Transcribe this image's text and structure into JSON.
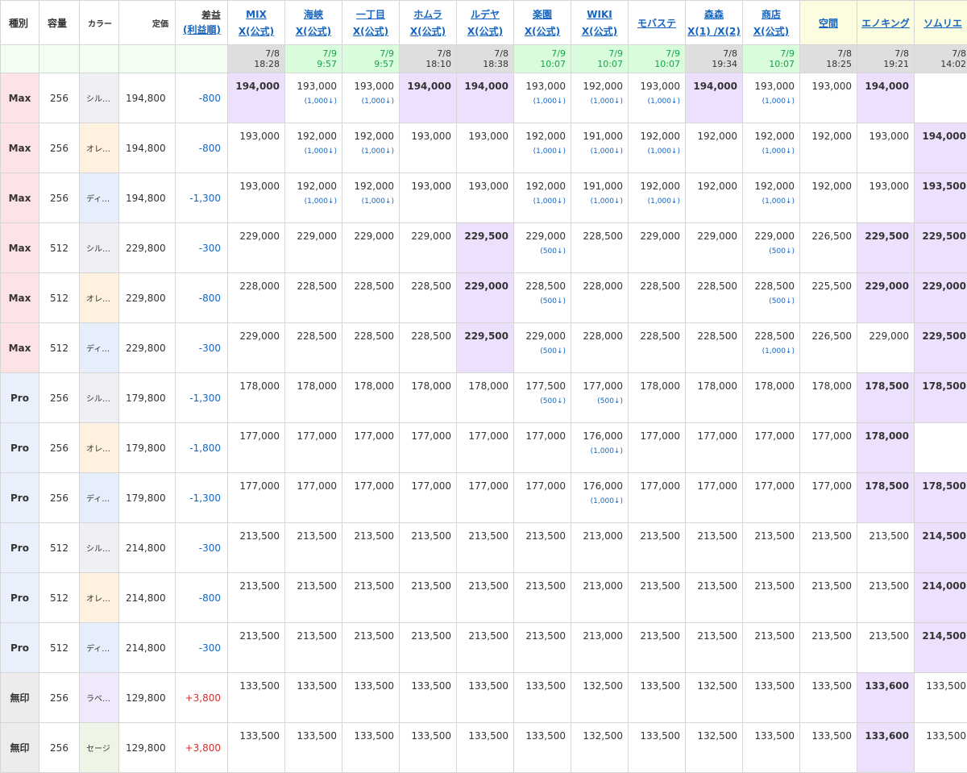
{
  "header": {
    "type": "種別",
    "capacity": "容量",
    "color": "カラー",
    "list_price": "定価",
    "diff_title": "差益",
    "diff_sort": "(利益順)"
  },
  "shops": [
    {
      "name": "MIX",
      "sub": "X(公式)",
      "date": "7/8",
      "time": "18:28",
      "time_style": "gray"
    },
    {
      "name": "海峡",
      "sub": "X(公式)",
      "date": "7/9",
      "time": "9:57",
      "time_style": "green"
    },
    {
      "name": "一丁目",
      "sub": "X(公式)",
      "date": "7/9",
      "time": "9:57",
      "time_style": "green"
    },
    {
      "name": "ホムラ",
      "sub": "X(公式)",
      "date": "7/8",
      "time": "18:10",
      "time_style": "gray"
    },
    {
      "name": "ルデヤ",
      "sub": "X(公式)",
      "date": "7/8",
      "time": "18:38",
      "time_style": "gray"
    },
    {
      "name": "楽園",
      "sub": "X(公式)",
      "date": "7/9",
      "time": "10:07",
      "time_style": "green"
    },
    {
      "name": "WIKI",
      "sub": "X(公式)",
      "date": "7/9",
      "time": "10:07",
      "time_style": "green"
    },
    {
      "name": "モバステ",
      "sub": "",
      "date": "7/9",
      "time": "10:07",
      "time_style": "green"
    },
    {
      "name": "森森",
      "sub": "X(1) /X(2)",
      "date": "7/8",
      "time": "19:34",
      "time_style": "gray"
    },
    {
      "name": "商店",
      "sub": "X(公式)",
      "date": "7/9",
      "time": "10:07",
      "time_style": "green"
    },
    {
      "name": "空間",
      "sub": "",
      "date": "7/8",
      "time": "18:25",
      "time_style": "gray"
    },
    {
      "name": "エノキング",
      "sub": "",
      "date": "7/8",
      "time": "19:21",
      "time_style": "gray"
    },
    {
      "name": "ソムリエ",
      "sub": "",
      "date": "7/8",
      "time": "14:02",
      "time_style": "gray"
    }
  ],
  "rows": [
    {
      "type": "Max",
      "cap": "256",
      "color": "シル…",
      "color_key": "silver",
      "list": "194,800",
      "diff": "-800",
      "prices": [
        [
          "194,000",
          "",
          1
        ],
        [
          "193,000",
          "(1,000↓)",
          0
        ],
        [
          "193,000",
          "(1,000↓)",
          0
        ],
        [
          "194,000",
          "",
          1
        ],
        [
          "194,000",
          "",
          1
        ],
        [
          "193,000",
          "(1,000↓)",
          0
        ],
        [
          "192,000",
          "(1,000↓)",
          0
        ],
        [
          "193,000",
          "(1,000↓)",
          0
        ],
        [
          "194,000",
          "",
          1
        ],
        [
          "193,000",
          "(1,000↓)",
          0
        ],
        [
          "193,000",
          "",
          0
        ],
        [
          "194,000",
          "",
          1
        ],
        [
          "",
          "",
          0
        ]
      ]
    },
    {
      "type": "Max",
      "cap": "256",
      "color": "オレ…",
      "color_key": "orange",
      "list": "194,800",
      "diff": "-800",
      "prices": [
        [
          "193,000",
          "",
          0
        ],
        [
          "192,000",
          "(1,000↓)",
          0
        ],
        [
          "192,000",
          "(1,000↓)",
          0
        ],
        [
          "193,000",
          "",
          0
        ],
        [
          "193,000",
          "",
          0
        ],
        [
          "192,000",
          "(1,000↓)",
          0
        ],
        [
          "191,000",
          "(1,000↓)",
          0
        ],
        [
          "192,000",
          "(1,000↓)",
          0
        ],
        [
          "192,000",
          "",
          0
        ],
        [
          "192,000",
          "(1,000↓)",
          0
        ],
        [
          "192,000",
          "",
          0
        ],
        [
          "193,000",
          "",
          0
        ],
        [
          "194,000",
          "",
          1
        ]
      ]
    },
    {
      "type": "Max",
      "cap": "256",
      "color": "ディ…",
      "color_key": "deep",
      "list": "194,800",
      "diff": "-1,300",
      "prices": [
        [
          "193,000",
          "",
          0
        ],
        [
          "192,000",
          "(1,000↓)",
          0
        ],
        [
          "192,000",
          "(1,000↓)",
          0
        ],
        [
          "193,000",
          "",
          0
        ],
        [
          "193,000",
          "",
          0
        ],
        [
          "192,000",
          "(1,000↓)",
          0
        ],
        [
          "191,000",
          "(1,000↓)",
          0
        ],
        [
          "192,000",
          "(1,000↓)",
          0
        ],
        [
          "192,000",
          "",
          0
        ],
        [
          "192,000",
          "(1,000↓)",
          0
        ],
        [
          "192,000",
          "",
          0
        ],
        [
          "193,000",
          "",
          0
        ],
        [
          "193,500",
          "",
          1
        ]
      ]
    },
    {
      "type": "Max",
      "cap": "512",
      "color": "シル…",
      "color_key": "silver",
      "list": "229,800",
      "diff": "-300",
      "prices": [
        [
          "229,000",
          "",
          0
        ],
        [
          "229,000",
          "",
          0
        ],
        [
          "229,000",
          "",
          0
        ],
        [
          "229,000",
          "",
          0
        ],
        [
          "229,500",
          "",
          1
        ],
        [
          "229,000",
          "(500↓)",
          0
        ],
        [
          "228,500",
          "",
          0
        ],
        [
          "229,000",
          "",
          0
        ],
        [
          "229,000",
          "",
          0
        ],
        [
          "229,000",
          "(500↓)",
          0
        ],
        [
          "226,500",
          "",
          0
        ],
        [
          "229,500",
          "",
          1
        ],
        [
          "229,500",
          "",
          1
        ]
      ]
    },
    {
      "type": "Max",
      "cap": "512",
      "color": "オレ…",
      "color_key": "orange",
      "list": "229,800",
      "diff": "-800",
      "prices": [
        [
          "228,000",
          "",
          0
        ],
        [
          "228,500",
          "",
          0
        ],
        [
          "228,500",
          "",
          0
        ],
        [
          "228,500",
          "",
          0
        ],
        [
          "229,000",
          "",
          1
        ],
        [
          "228,500",
          "(500↓)",
          0
        ],
        [
          "228,000",
          "",
          0
        ],
        [
          "228,500",
          "",
          0
        ],
        [
          "228,500",
          "",
          0
        ],
        [
          "228,500",
          "(500↓)",
          0
        ],
        [
          "225,500",
          "",
          0
        ],
        [
          "229,000",
          "",
          1
        ],
        [
          "229,000",
          "",
          1
        ]
      ]
    },
    {
      "type": "Max",
      "cap": "512",
      "color": "ディ…",
      "color_key": "deep",
      "list": "229,800",
      "diff": "-300",
      "prices": [
        [
          "229,000",
          "",
          0
        ],
        [
          "228,500",
          "",
          0
        ],
        [
          "228,500",
          "",
          0
        ],
        [
          "228,500",
          "",
          0
        ],
        [
          "229,500",
          "",
          1
        ],
        [
          "229,000",
          "(500↓)",
          0
        ],
        [
          "228,000",
          "",
          0
        ],
        [
          "228,500",
          "",
          0
        ],
        [
          "228,500",
          "",
          0
        ],
        [
          "228,500",
          "(1,000↓)",
          0
        ],
        [
          "226,500",
          "",
          0
        ],
        [
          "229,000",
          "",
          0
        ],
        [
          "229,500",
          "",
          1
        ]
      ]
    },
    {
      "type": "Pro",
      "cap": "256",
      "color": "シル…",
      "color_key": "silver",
      "list": "179,800",
      "diff": "-1,300",
      "prices": [
        [
          "178,000",
          "",
          0
        ],
        [
          "178,000",
          "",
          0
        ],
        [
          "178,000",
          "",
          0
        ],
        [
          "178,000",
          "",
          0
        ],
        [
          "178,000",
          "",
          0
        ],
        [
          "177,500",
          "(500↓)",
          0
        ],
        [
          "177,000",
          "(500↓)",
          0
        ],
        [
          "178,000",
          "",
          0
        ],
        [
          "178,000",
          "",
          0
        ],
        [
          "178,000",
          "",
          0
        ],
        [
          "178,000",
          "",
          0
        ],
        [
          "178,500",
          "",
          1
        ],
        [
          "178,500",
          "",
          1
        ]
      ]
    },
    {
      "type": "Pro",
      "cap": "256",
      "color": "オレ…",
      "color_key": "orange",
      "list": "179,800",
      "diff": "-1,800",
      "prices": [
        [
          "177,000",
          "",
          0
        ],
        [
          "177,000",
          "",
          0
        ],
        [
          "177,000",
          "",
          0
        ],
        [
          "177,000",
          "",
          0
        ],
        [
          "177,000",
          "",
          0
        ],
        [
          "177,000",
          "",
          0
        ],
        [
          "176,000",
          "(1,000↓)",
          0
        ],
        [
          "177,000",
          "",
          0
        ],
        [
          "177,000",
          "",
          0
        ],
        [
          "177,000",
          "",
          0
        ],
        [
          "177,000",
          "",
          0
        ],
        [
          "178,000",
          "",
          1
        ],
        [
          "",
          "",
          0
        ]
      ]
    },
    {
      "type": "Pro",
      "cap": "256",
      "color": "ディ…",
      "color_key": "deep",
      "list": "179,800",
      "diff": "-1,300",
      "prices": [
        [
          "177,000",
          "",
          0
        ],
        [
          "177,000",
          "",
          0
        ],
        [
          "177,000",
          "",
          0
        ],
        [
          "177,000",
          "",
          0
        ],
        [
          "177,000",
          "",
          0
        ],
        [
          "177,000",
          "",
          0
        ],
        [
          "176,000",
          "(1,000↓)",
          0
        ],
        [
          "177,000",
          "",
          0
        ],
        [
          "177,000",
          "",
          0
        ],
        [
          "177,000",
          "",
          0
        ],
        [
          "177,000",
          "",
          0
        ],
        [
          "178,500",
          "",
          1
        ],
        [
          "178,500",
          "",
          1
        ]
      ]
    },
    {
      "type": "Pro",
      "cap": "512",
      "color": "シル…",
      "color_key": "silver",
      "list": "214,800",
      "diff": "-300",
      "prices": [
        [
          "213,500",
          "",
          0
        ],
        [
          "213,500",
          "",
          0
        ],
        [
          "213,500",
          "",
          0
        ],
        [
          "213,500",
          "",
          0
        ],
        [
          "213,500",
          "",
          0
        ],
        [
          "213,500",
          "",
          0
        ],
        [
          "213,000",
          "",
          0
        ],
        [
          "213,500",
          "",
          0
        ],
        [
          "213,500",
          "",
          0
        ],
        [
          "213,500",
          "",
          0
        ],
        [
          "213,500",
          "",
          0
        ],
        [
          "213,500",
          "",
          0
        ],
        [
          "214,500",
          "",
          1
        ]
      ]
    },
    {
      "type": "Pro",
      "cap": "512",
      "color": "オレ…",
      "color_key": "orange",
      "list": "214,800",
      "diff": "-800",
      "prices": [
        [
          "213,500",
          "",
          0
        ],
        [
          "213,500",
          "",
          0
        ],
        [
          "213,500",
          "",
          0
        ],
        [
          "213,500",
          "",
          0
        ],
        [
          "213,500",
          "",
          0
        ],
        [
          "213,500",
          "",
          0
        ],
        [
          "213,000",
          "",
          0
        ],
        [
          "213,500",
          "",
          0
        ],
        [
          "213,500",
          "",
          0
        ],
        [
          "213,500",
          "",
          0
        ],
        [
          "213,500",
          "",
          0
        ],
        [
          "213,500",
          "",
          0
        ],
        [
          "214,000",
          "",
          1
        ]
      ]
    },
    {
      "type": "Pro",
      "cap": "512",
      "color": "ディ…",
      "color_key": "deep",
      "list": "214,800",
      "diff": "-300",
      "prices": [
        [
          "213,500",
          "",
          0
        ],
        [
          "213,500",
          "",
          0
        ],
        [
          "213,500",
          "",
          0
        ],
        [
          "213,500",
          "",
          0
        ],
        [
          "213,500",
          "",
          0
        ],
        [
          "213,500",
          "",
          0
        ],
        [
          "213,000",
          "",
          0
        ],
        [
          "213,500",
          "",
          0
        ],
        [
          "213,500",
          "",
          0
        ],
        [
          "213,500",
          "",
          0
        ],
        [
          "213,500",
          "",
          0
        ],
        [
          "213,500",
          "",
          0
        ],
        [
          "214,500",
          "",
          1
        ]
      ]
    },
    {
      "type": "無印",
      "cap": "256",
      "color": "ラベ…",
      "color_key": "lavender",
      "list": "129,800",
      "diff": "+3,800",
      "prices": [
        [
          "133,500",
          "",
          0
        ],
        [
          "133,500",
          "",
          0
        ],
        [
          "133,500",
          "",
          0
        ],
        [
          "133,500",
          "",
          0
        ],
        [
          "133,500",
          "",
          0
        ],
        [
          "133,500",
          "",
          0
        ],
        [
          "132,500",
          "",
          0
        ],
        [
          "133,500",
          "",
          0
        ],
        [
          "132,500",
          "",
          0
        ],
        [
          "133,500",
          "",
          0
        ],
        [
          "133,500",
          "",
          0
        ],
        [
          "133,600",
          "",
          1
        ],
        [
          "133,500",
          "",
          0
        ]
      ]
    },
    {
      "type": "無印",
      "cap": "256",
      "color": "セージ",
      "color_key": "sage",
      "list": "129,800",
      "diff": "+3,800",
      "prices": [
        [
          "133,500",
          "",
          0
        ],
        [
          "133,500",
          "",
          0
        ],
        [
          "133,500",
          "",
          0
        ],
        [
          "133,500",
          "",
          0
        ],
        [
          "133,500",
          "",
          0
        ],
        [
          "133,500",
          "",
          0
        ],
        [
          "132,500",
          "",
          0
        ],
        [
          "133,500",
          "",
          0
        ],
        [
          "132,500",
          "",
          0
        ],
        [
          "133,500",
          "",
          0
        ],
        [
          "133,500",
          "",
          0
        ],
        [
          "133,600",
          "",
          1
        ],
        [
          "133,500",
          "",
          0
        ]
      ]
    }
  ]
}
